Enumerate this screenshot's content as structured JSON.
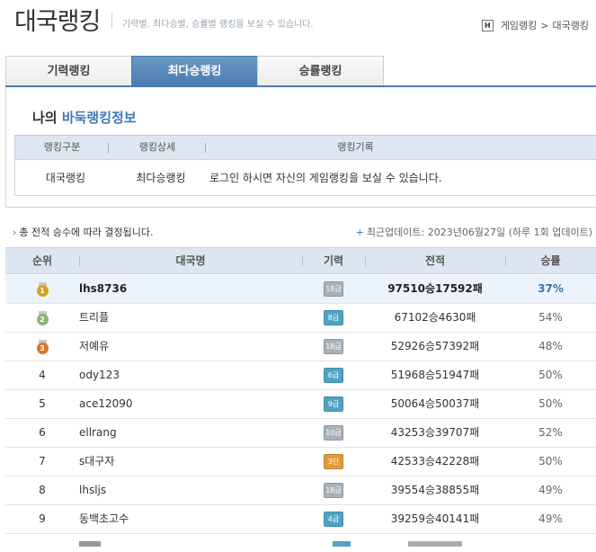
{
  "header": {
    "title": "대국랭킹",
    "subtitle": "기력별, 최다승별, 승률별 랭킹을 보실 수 있습니다.",
    "breadcrumb": {
      "home_icon": "H",
      "parent": "게임랭킹",
      "sep": ">",
      "current": "대국랭킹"
    }
  },
  "tabs": [
    {
      "label": "기력랭킹",
      "active": false
    },
    {
      "label": "최다승랭킹",
      "active": true
    },
    {
      "label": "승률랭킹",
      "active": false
    }
  ],
  "my_info": {
    "title_prefix": "나의 ",
    "title_highlight": "바둑랭킹정보",
    "headers": [
      "랭킹구분",
      "랭킹상세",
      "랭킹기록"
    ],
    "row": {
      "type": "대국랭킹",
      "detail": "최다승랭킹",
      "record": "로그인 하시면 자신의 게임랭킹을 보실 수 있습니다."
    }
  },
  "notice": {
    "arrow": "›",
    "text": "총 전적 승수에 따라 결정됩니다."
  },
  "update": {
    "plus": "+",
    "text": "최근업데이트: 2023년06월27일 (하루 1회 업데이트)"
  },
  "table": {
    "headers": [
      "순위",
      "대국명",
      "기력",
      "전적",
      "승률"
    ],
    "rows": [
      {
        "rank": "1",
        "name": "lhs8736",
        "level": "18급",
        "record": "97510승17592패",
        "rate": "37%"
      },
      {
        "rank": "2",
        "name": "트리플",
        "level": "8급",
        "record": "67102승4630패",
        "rate": "54%"
      },
      {
        "rank": "3",
        "name": "저예유",
        "level": "18급",
        "record": "52926승57392패",
        "rate": "48%"
      },
      {
        "rank": "4",
        "name": "ody123",
        "level": "6급",
        "record": "51968승51947패",
        "rate": "50%"
      },
      {
        "rank": "5",
        "name": "ace12090",
        "level": "9급",
        "record": "50064승50037패",
        "rate": "50%"
      },
      {
        "rank": "6",
        "name": "ellrang",
        "level": "10급",
        "record": "43253승39707패",
        "rate": "52%"
      },
      {
        "rank": "7",
        "name": "s대구자",
        "level": "3단",
        "record": "42533승42228패",
        "rate": "50%"
      },
      {
        "rank": "8",
        "name": "lhsljs",
        "level": "18급",
        "record": "39554승38855패",
        "rate": "49%"
      },
      {
        "rank": "9",
        "name": "동백초고수",
        "level": "4급",
        "record": "39259승40141패",
        "rate": "49%"
      }
    ]
  },
  "colors": {
    "accent": "#4a7bb1",
    "medal_gold": "#d9a21b",
    "medal_silver": "#8fb27a",
    "medal_bronze": "#d9742b",
    "badge_gray": "#a9b1ba",
    "badge_blue": "#4fa4c4",
    "badge_orange": "#e39a3b"
  }
}
